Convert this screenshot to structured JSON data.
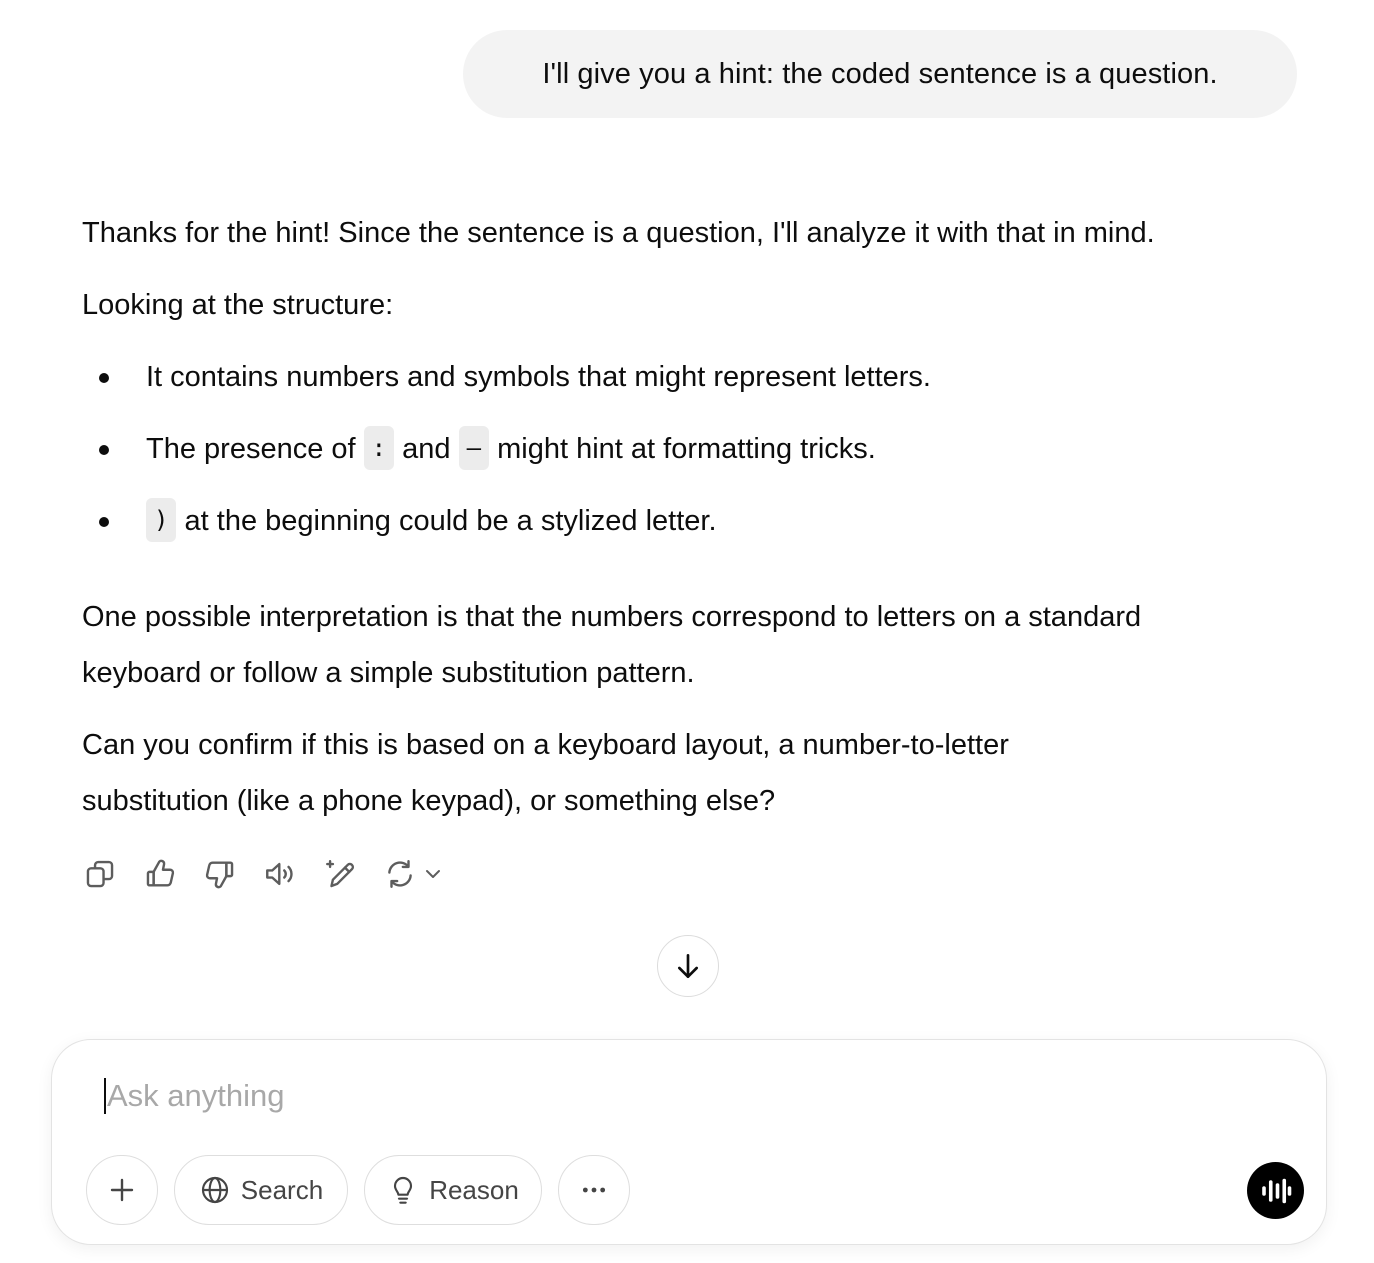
{
  "user_message": "I'll give you a hint: the coded sentence is a question.",
  "assistant": {
    "intro": "Thanks for the hint! Since the sentence is a question, I'll analyze it with that in mind.",
    "structure_heading": "Looking at the structure:",
    "bullets": [
      {
        "text": "It contains numbers and symbols that might represent letters."
      },
      {
        "prefix": "The presence of",
        "code1": ":",
        "middle": "and",
        "code2": "–",
        "suffix": "might hint at formatting tricks."
      },
      {
        "code": ")",
        "text": "at the beginning could be a stylized letter."
      }
    ],
    "interpretation_line1": "One possible interpretation is that the numbers correspond to letters on a standard",
    "interpretation_line2": "keyboard or follow a simple substitution pattern.",
    "question_line1": "Can you confirm if this is based on a keyboard layout, a number-to-letter",
    "question_line2": "substitution (like a phone keypad), or something else?"
  },
  "action_icons": [
    "copy-icon",
    "thumbs-up-icon",
    "thumbs-down-icon",
    "read-aloud-icon",
    "edit-sparkle-icon",
    "regenerate-icon",
    "chevron-down-icon"
  ],
  "scroll_icon": "arrow-down-icon",
  "composer": {
    "placeholder": "Ask anything",
    "value": "",
    "attach_icon": "plus-icon",
    "search_label": "Search",
    "search_icon": "globe-icon",
    "reason_label": "Reason",
    "reason_icon": "lightbulb-icon",
    "more_icon": "ellipsis-icon",
    "voice_icon": "voice-waveform-icon"
  },
  "colors": {
    "text": "#0d0d0d",
    "user_bubble_bg": "#f3f3f3",
    "placeholder": "#a8a8a8",
    "icon_gray": "#5d5d5d",
    "voice_button_bg": "#000000"
  }
}
